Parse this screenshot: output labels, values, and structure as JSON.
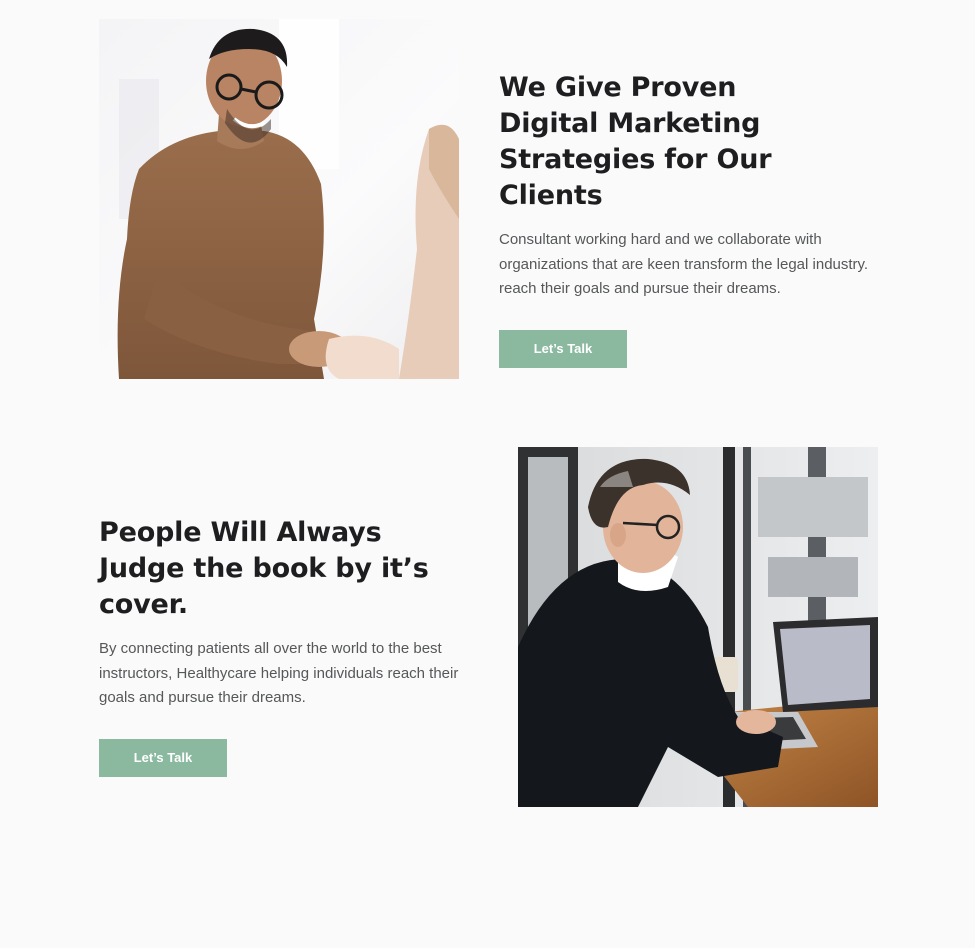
{
  "sections": [
    {
      "heading": "We Give Proven Digital Marketing Strategies for Our Clients",
      "paragraph": "Consultant working hard and we collaborate with organizations that are keen transform the legal industry. reach their goals and pursue their dreams.",
      "button_label": "Let’s Talk"
    },
    {
      "heading": "People Will Always Judge the book by it’s cover.",
      "paragraph": "By connecting patients all over the world to the best instructors, Healthycare helping individuals reach their goals and pursue their dreams.",
      "button_label": "Let’s Talk"
    }
  ],
  "colors": {
    "page_background": "#fafafa",
    "heading": "#1e1e20",
    "body_text": "#555759",
    "button_background": "#8ab9a0",
    "button_text": "#ffffff"
  }
}
